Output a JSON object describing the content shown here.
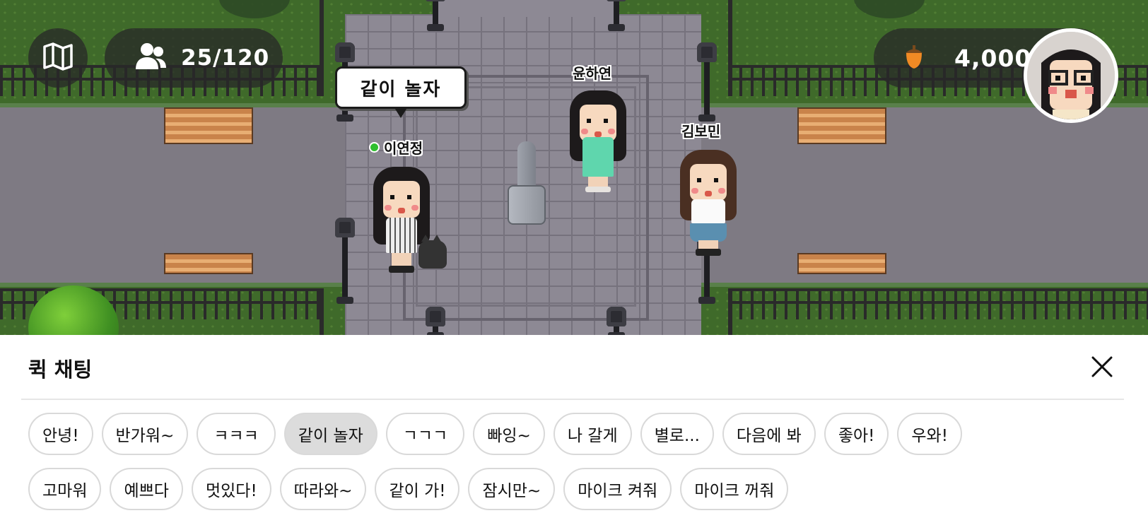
{
  "hud": {
    "online_count": "25/120",
    "coins": "4,000",
    "coin_color": "#f08a24"
  },
  "speech_bubble": "같이 놀자",
  "characters": {
    "player": {
      "name": "이연정",
      "online": true,
      "status_color": "#2fbf2f"
    },
    "npc1": {
      "name": "윤하연"
    },
    "npc2": {
      "name": "김보민"
    }
  },
  "quick_chat": {
    "title": "퀵 채팅",
    "selected_phrase": "같이 놀자",
    "row1": [
      "안녕!",
      "반가워~",
      "ㅋㅋㅋ",
      "같이 놀자",
      "ㄱㄱㄱ",
      "빠잉~",
      "나 갈게",
      "별로...",
      "다음에 봐",
      "좋아!",
      "우와!"
    ],
    "row2": [
      "고마워",
      "예쁘다",
      "멋있다!",
      "따라와~",
      "같이 가!",
      "잠시만~",
      "마이크 켜줘",
      "마이크 꺼줘"
    ]
  },
  "icons": {
    "map": "map-icon",
    "users": "users-icon",
    "coin": "acorn-coin-icon",
    "close": "close-icon"
  }
}
